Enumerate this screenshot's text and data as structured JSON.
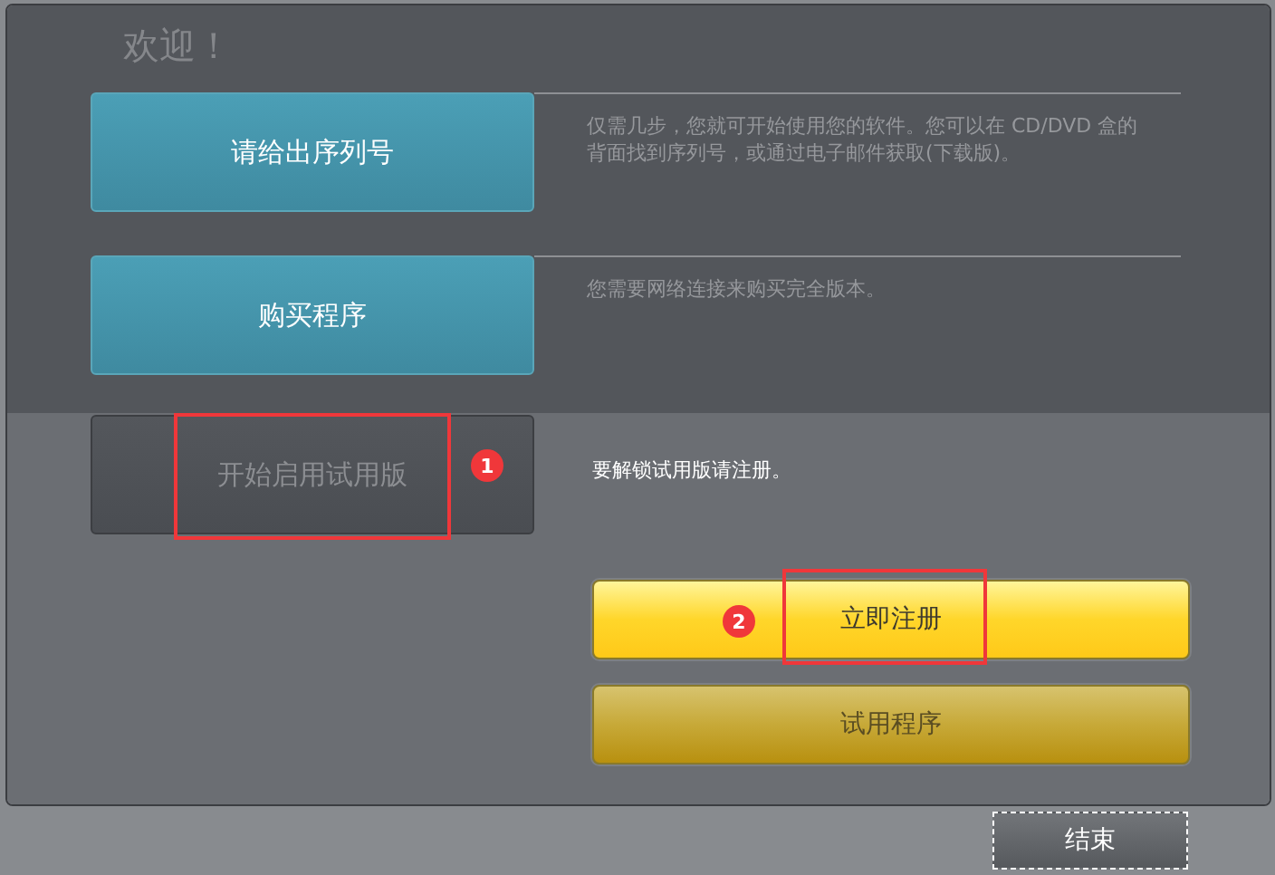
{
  "title": "欢迎！",
  "options": [
    {
      "label": "请给出序列号",
      "description": "仅需几步，您就可开始使用您的软件。您可以在 CD/DVD 盒的背面找到序列号，或通过电子邮件获取(下载版)。",
      "selected": false
    },
    {
      "label": "购买程序",
      "description": "您需要网络连接来购买完全版本。",
      "selected": false
    },
    {
      "label": "开始启用试用版",
      "description": "要解锁试用版请注册。",
      "selected": true,
      "callout": "1"
    }
  ],
  "actions": [
    {
      "label": "立即注册",
      "kind": "primary",
      "callout": "2"
    },
    {
      "label": "试用程序",
      "kind": "secondary"
    }
  ],
  "footer_button": {
    "label": "结束",
    "focused": true
  }
}
